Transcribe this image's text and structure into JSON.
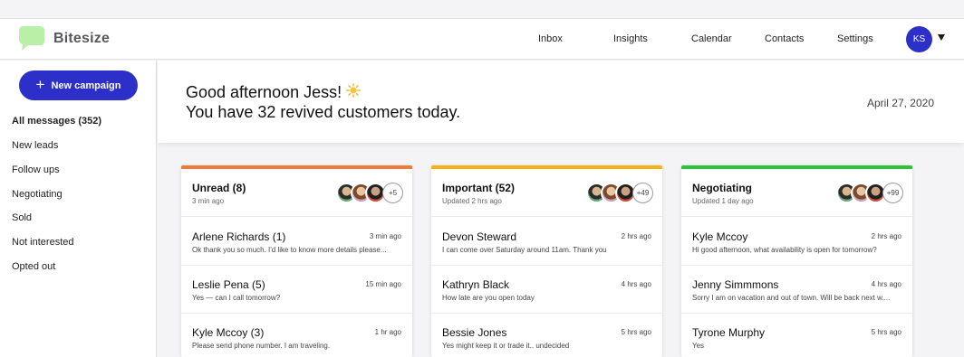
{
  "app": {
    "brand": "Bitesize",
    "logo_icon": "speech-bubble-icon",
    "brand_color": "#b8f0a7",
    "accent": "#2d2fc9"
  },
  "nav": {
    "links": [
      "Inbox",
      "Insights",
      "Calendar",
      "Contacts",
      "Settings"
    ],
    "avatar_initials": "KS",
    "menu_icon": "chevron-down-icon"
  },
  "sidebar": {
    "new_button": "New campaign",
    "items": [
      "All messages (352)",
      "New leads",
      "Follow ups",
      "Negotiating",
      "Sold",
      "Not interested",
      "Opted out"
    ]
  },
  "greeting": {
    "line1": "Good afternoon Jess!",
    "emoji_icon": "sun-icon",
    "line2": "You have 32 revived customers today.",
    "date": "April 27, 2020"
  },
  "columns": [
    {
      "title": "Unread (8)",
      "subtitle": "3 min ago",
      "bar_color": "#f07a3a",
      "more": "+5",
      "messages": [
        {
          "name": "Arlene Richards (1)",
          "time": "3 min ago",
          "preview": "Ok thank you so much. I'd like to know more details please..."
        },
        {
          "name": "Leslie Pena (5)",
          "time": "15 min ago",
          "preview": "Yes — can I call tomorrow?"
        },
        {
          "name": "Kyle Mccoy (3)",
          "time": "1 hr ago",
          "preview": "Please send phone number. I am traveling."
        }
      ]
    },
    {
      "title": "Important (52)",
      "subtitle": "Updated 2 hrs ago",
      "bar_color": "#f5b21b",
      "more": "+49",
      "messages": [
        {
          "name": "Devon Steward",
          "time": "2 hrs ago",
          "preview": "I can come over Saturday around 11am. Thank you"
        },
        {
          "name": "Kathryn Black",
          "time": "4 hrs ago",
          "preview": "How late are you open today"
        },
        {
          "name": "Bessie Jones",
          "time": "5 hrs ago",
          "preview": "Yes might keep it or trade it.. undecided"
        }
      ]
    },
    {
      "title": "Negotiating",
      "subtitle": "Updated 1 day ago",
      "bar_color": "#2ec236",
      "more": "+99",
      "messages": [
        {
          "name": "Kyle Mccoy",
          "time": "2 hrs ago",
          "preview": "Hi good afternoon, what availability is open for tomorrow?"
        },
        {
          "name": "Jenny Simmmons",
          "time": "4 hrs ago",
          "preview": "Sorry I am on vacation and out of town. Will be back next w...."
        },
        {
          "name": "Tyrone Murphy",
          "time": "5 hrs ago",
          "preview": "Yes"
        }
      ]
    }
  ]
}
